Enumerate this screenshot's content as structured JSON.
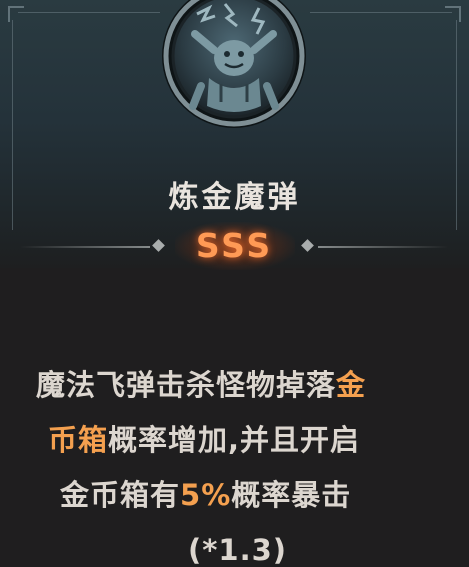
{
  "skill": {
    "name": "炼金魔弹",
    "grade": "SSS",
    "icon": "alchemy-golem-icon"
  },
  "description": {
    "line1_text": "魔法飞弹击杀怪物掉落",
    "line1_highlight": "金",
    "line2_highlight": "币箱",
    "line2_text": "概率增加,并且开启",
    "line3_text_before": "金币箱有",
    "line3_highlight": "5%",
    "line3_text_after": "概率暴击",
    "line4_text": "(*1.3)"
  },
  "colors": {
    "panel": "#26353c",
    "background": "#1f1e1f",
    "grade": "#ff9a55",
    "highlight": "#f4a04f",
    "text": "#dcd6cf"
  }
}
